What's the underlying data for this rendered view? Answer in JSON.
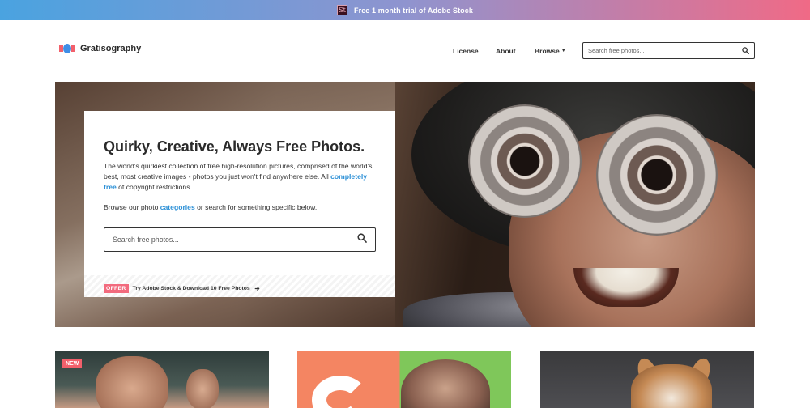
{
  "promo": {
    "badge": "St",
    "text": "Free 1 month trial of Adobe Stock"
  },
  "header": {
    "logo_text": "Gratisography",
    "nav": {
      "license": "License",
      "about": "About",
      "browse": "Browse"
    },
    "search_placeholder": "Search free photos..."
  },
  "hero": {
    "title": "Quirky, Creative, Always Free Photos.",
    "desc_part1": "The world's quirkiest collection of free high-resolution pictures, comprised of the world's best, most creative images - photos you just won't find anywhere else. All ",
    "desc_link": "completely free",
    "desc_part2": " of copyright restrictions.",
    "browse_part1": "Browse our photo ",
    "browse_link": "categories",
    "browse_part2": " or search for something specific below.",
    "search_placeholder": "Search free photos...",
    "offer_badge": "OFFER",
    "offer_text": "Try Adobe Stock & Download 10 Free Photos"
  },
  "thumbnails": {
    "new_badge": "NEW"
  },
  "colors": {
    "accent_link": "#2a8fd6",
    "badge": "#f26b7e",
    "promo_gradient_start": "#4aa3e0",
    "promo_gradient_end": "#f06a86"
  },
  "icons": {
    "search": "search-icon",
    "caret": "caret-down-icon",
    "arrow": "arrow-right-icon"
  }
}
